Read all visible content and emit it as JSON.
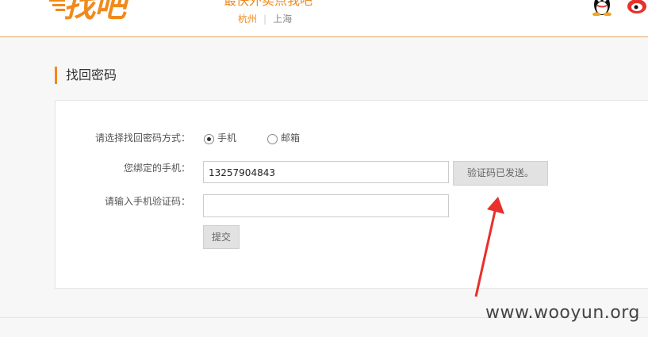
{
  "header": {
    "logo_text": "找吧",
    "slogan": "最快外卖点我吧",
    "cities": [
      "杭州",
      "上海"
    ],
    "separator": "|"
  },
  "page": {
    "title": "找回密码"
  },
  "form": {
    "method_label": "请选择找回密码方式：",
    "method_options": [
      {
        "label": "手机",
        "selected": true
      },
      {
        "label": "邮箱",
        "selected": false
      }
    ],
    "phone_label": "您绑定的手机：",
    "phone_value": "13257904843",
    "send_code_button": "验证码已发送。",
    "code_label": "请输入手机验证码：",
    "code_value": "",
    "submit_button": "提交"
  },
  "watermark": "www.wooyun.org",
  "colors": {
    "accent": "#f08a1c",
    "annotation_arrow": "#e8302c"
  }
}
